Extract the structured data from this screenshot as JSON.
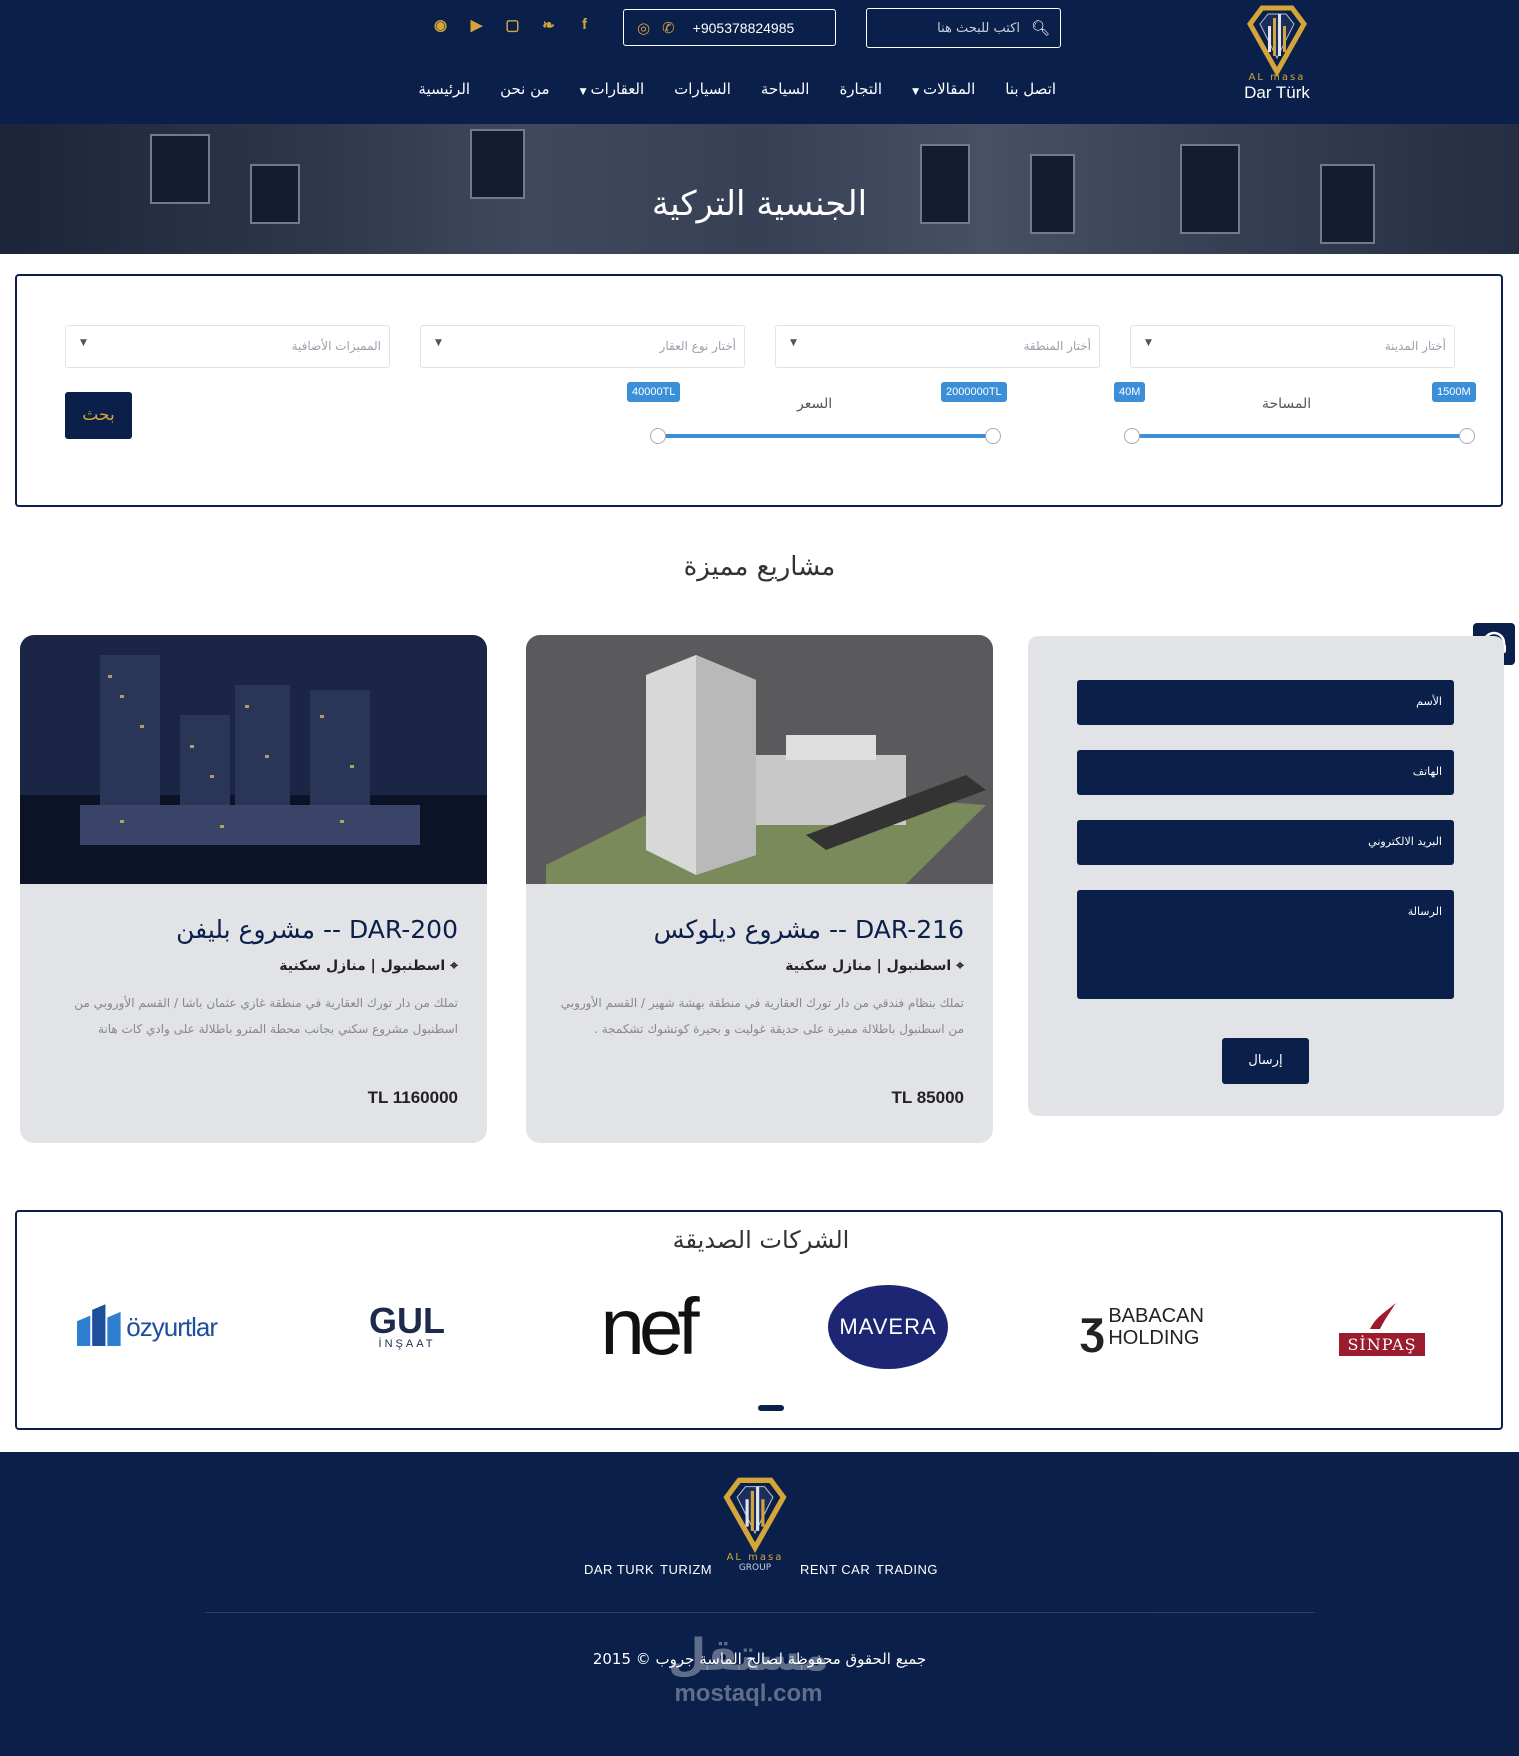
{
  "brand": {
    "small": "AL masa",
    "name": "Dar Türk"
  },
  "header": {
    "search_placeholder": "اكتب للبحث هنا",
    "phone": "+905378824985",
    "socials": [
      "messenger-icon",
      "youtube-icon",
      "instagram-icon",
      "twitter-icon",
      "facebook-icon"
    ]
  },
  "nav": [
    {
      "label": "الرئيسية",
      "dropdown": false
    },
    {
      "label": "من نحن",
      "dropdown": false
    },
    {
      "label": "العقارات",
      "dropdown": true
    },
    {
      "label": "السيارات",
      "dropdown": false
    },
    {
      "label": "السياحة",
      "dropdown": false
    },
    {
      "label": "التجارة",
      "dropdown": false
    },
    {
      "label": "المقالات",
      "dropdown": true
    },
    {
      "label": "اتصل بنا",
      "dropdown": false
    }
  ],
  "hero": {
    "title": "الجنسية التركية"
  },
  "filter": {
    "city": "أختار المدينة",
    "region": "أختار المنطقة",
    "type": "أختار نوع العقار",
    "features": "المميزات الأضافية",
    "area_label": "المساحة",
    "area_min": "40M",
    "area_max": "1500M",
    "price_label": "السعر",
    "price_min": "40000TL",
    "price_max": "2000000TL",
    "search_button": "بحث"
  },
  "featured": {
    "title": "مشاريع مميزة",
    "projects": [
      {
        "title": "DAR-216 -- مشروع ديلوكس",
        "location": "اسطنبول | منازل سكنية",
        "description": "تملك بنظام فندقي من دار تورك العقارية في منطقة بهشة شهير / القسم الأوروبي من اسطنبول باطلالة مميزة على حديقة غوليت و بحيرة كوتشوك تشكمجة .",
        "price": "TL 85000"
      },
      {
        "title": "DAR-200 -- مشروع بليفن",
        "location": "اسطنبول | منازل سكنية",
        "description": "تملك من دار تورك العقارية في منطقة غازي عثمان باشا / القسم الأوروبي من اسطنبول مشروع سكني بجانب محطة المترو باطلالة على وادي كات هانة",
        "price": "TL 1160000"
      }
    ]
  },
  "contact": {
    "name": "الأسم",
    "phone": "الهاتف",
    "email": "البريد الالكتروني",
    "message": "الرسالة",
    "send": "إرسال"
  },
  "partners": {
    "title": "الشركات الصديقة",
    "logos": [
      "SİNPAŞ",
      "BABACAN",
      "HOLDING",
      "MAVERA",
      "nef",
      "GUL",
      "İNŞAAT",
      "özyurtlar"
    ]
  },
  "footer": {
    "links_left": [
      "DAR TURK",
      "TURIZM"
    ],
    "links_right": [
      "RENT CAR",
      "TRADING"
    ],
    "logo_small": "AL masa",
    "logo_group": "GROUP",
    "copyright": "جميع الحقوق محفوظة لصالح الماسة جروب © 2015",
    "watermark_ar": "مستقل",
    "watermark_en": "mostaql.com"
  },
  "colors": {
    "navy": "#0a1f4a",
    "gold": "#d4a63a",
    "slider": "#3a8fd8",
    "card": "#e2e3e6"
  }
}
